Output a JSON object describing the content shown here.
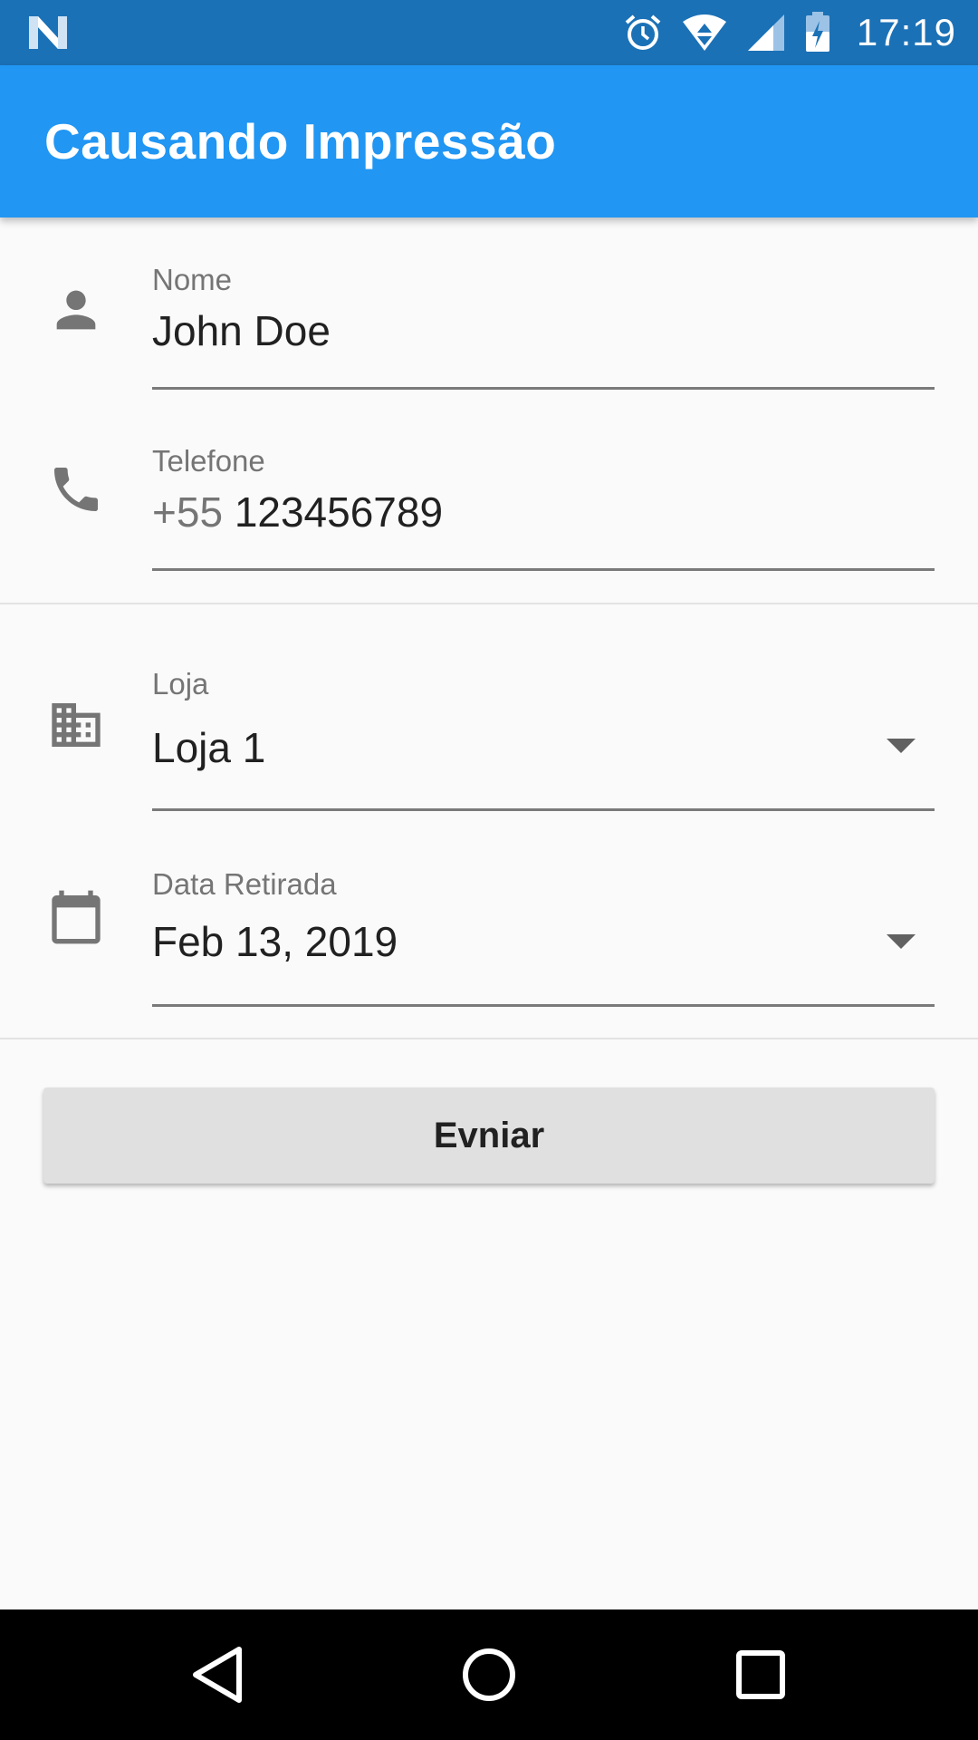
{
  "status_bar": {
    "time": "17:19",
    "icons": [
      "notification-n-icon",
      "alarm-icon",
      "wifi-icon",
      "cell-signal-icon",
      "battery-charging-icon"
    ]
  },
  "app_bar": {
    "title": "Causando Impressão"
  },
  "form": {
    "name": {
      "label": "Nome",
      "value": "John Doe",
      "icon": "person-icon"
    },
    "phone": {
      "label": "Telefone",
      "prefix": "+55 ",
      "value": "123456789",
      "icon": "phone-icon"
    },
    "store": {
      "label": "Loja",
      "value": "Loja 1",
      "icon": "business-icon"
    },
    "pickup_date": {
      "label": "Data Retirada",
      "value": "Feb 13, 2019",
      "icon": "calendar-icon"
    }
  },
  "submit_button": {
    "label": "Evniar"
  },
  "nav_bar": {
    "icons": [
      "back-icon",
      "home-icon",
      "recents-icon"
    ]
  },
  "colors": {
    "status_bar": "#1b71b6",
    "app_bar": "#2196f3",
    "background": "#fafafa",
    "button": "#e0e0e0"
  }
}
